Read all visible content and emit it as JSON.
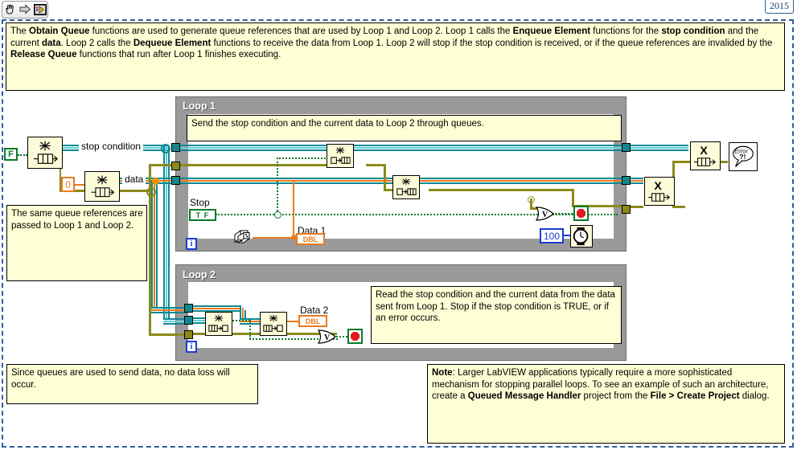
{
  "window": {
    "version_tab": "2015",
    "toolbar": {
      "items": [
        {
          "name": "hand-tool-icon",
          "label": "Operate Value"
        },
        {
          "name": "arrow-tool-icon",
          "label": "Position / Size / Select"
        },
        {
          "name": "vi-icon",
          "label": "VI Icon"
        }
      ]
    }
  },
  "main_description": {
    "segments": [
      {
        "text": "The ",
        "bold": false
      },
      {
        "text": "Obtain Queue",
        "bold": true
      },
      {
        "text": " functions are used to generate queue references that are used by Loop 1 and Loop 2. Loop 1 calls the ",
        "bold": false
      },
      {
        "text": "Enqueue Element",
        "bold": true
      },
      {
        "text": " functions for the ",
        "bold": false
      },
      {
        "text": "stop condition",
        "bold": true
      },
      {
        "text": " and the current ",
        "bold": false
      },
      {
        "text": "data",
        "bold": true
      },
      {
        "text": ". Loop 2 calls the ",
        "bold": false
      },
      {
        "text": "Dequeue Element",
        "bold": true
      },
      {
        "text": " functions to receive the data from Loop 1. Loop 2 will stop if the stop condition is received, or if the queue references are invalided by the ",
        "bold": false
      },
      {
        "text": "Release Queue",
        "bold": true
      },
      {
        "text": " functions that run after Loop 1 finishes executing.",
        "bold": false
      }
    ]
  },
  "notes": {
    "queue_refs": "The same queue references are passed to Loop 1 and Loop 2.",
    "no_data_loss": "Since queues are used to send data, no data loss will occur.",
    "labview_note": [
      {
        "text": "Note",
        "bold": true
      },
      {
        "text": ": Larger LabVIEW applications typically require a more sophisticated mechanism for stopping parallel loops. To see an example of such an architecture, create a ",
        "bold": false
      },
      {
        "text": "Queued Message Handler",
        "bold": true
      },
      {
        "text": " project from the ",
        "bold": false
      },
      {
        "text": "File > Create Project",
        "bold": true
      },
      {
        "text": " dialog.",
        "bold": false
      }
    ]
  },
  "loop1": {
    "title": "Loop 1",
    "comment": "Send the stop condition and the current data to Loop 2 through queues.",
    "stop_control_label": "Stop",
    "stop_control_value": "T F",
    "data_indicator_label": "Data 1",
    "data_indicator_type": "DBL",
    "iteration_terminal": "i",
    "wait_constant": "100",
    "nodes": [
      {
        "name": "enqueue-element-stop",
        "label": "Enqueue Element"
      },
      {
        "name": "enqueue-element-data",
        "label": "Enqueue Element"
      },
      {
        "name": "random-number-icon",
        "label": "Random Number (0-1)"
      },
      {
        "name": "or-gate-icon",
        "label": "Or"
      },
      {
        "name": "wait-ms-icon",
        "label": "Wait (ms)"
      },
      {
        "name": "stop-terminal-icon",
        "label": "Loop Condition"
      }
    ]
  },
  "loop2": {
    "title": "Loop 2",
    "comment": "Read the stop condition and the current data from the data sent from Loop 1. Stop if the stop condition is TRUE, or if an error occurs.",
    "data_indicator_label": "Data 2",
    "data_indicator_type": "DBL",
    "iteration_terminal": "i",
    "nodes": [
      {
        "name": "dequeue-element-stop",
        "label": "Dequeue Element"
      },
      {
        "name": "dequeue-element-data",
        "label": "Dequeue Element"
      },
      {
        "name": "or-gate-icon",
        "label": "Or"
      },
      {
        "name": "stop-terminal-icon",
        "label": "Loop Condition"
      }
    ]
  },
  "left_section": {
    "false_constant": "F",
    "zero_constant": "0",
    "wire_label_stop": "stop condition",
    "wire_label_data": "data",
    "nodes": [
      {
        "name": "obtain-queue-stop",
        "label": "Obtain Queue"
      },
      {
        "name": "obtain-queue-data",
        "label": "Obtain Queue"
      }
    ]
  },
  "right_section": {
    "nodes": [
      {
        "name": "release-queue-stop",
        "label": "Release Queue"
      },
      {
        "name": "release-queue-data",
        "label": "Release Queue"
      },
      {
        "name": "simple-error-handler",
        "label": "Simple Error Handler"
      }
    ],
    "error_handler_text": [
      "Error",
      "?!"
    ]
  },
  "colors": {
    "comment_bg": "#FEFFD4",
    "loop_frame": "#9A9A9A",
    "queue_wire": "#0F8A93",
    "error_wire": "#8C8A19",
    "numeric_wire": "#E87B1E",
    "boolean_wire": "#0A7A2A",
    "frame_border": "#2F5F9E"
  }
}
